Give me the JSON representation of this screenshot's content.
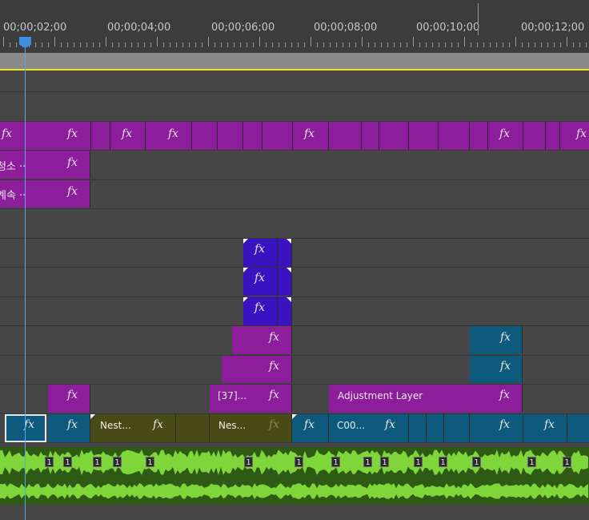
{
  "ruler": {
    "timecodes": [
      "00;00;02;00",
      "00;00;04;00",
      "00;00;06;00",
      "00;00;08;00",
      "00;00;10;00",
      "00;00;12;00"
    ]
  },
  "clips": {
    "fx_label": "fx",
    "v8_korean_1": "청소",
    "v8_korean_1_tail": "..",
    "v7_korean_2": "계속",
    "v7_korean_2_tail": "..",
    "v2_nest_37": "[37]...",
    "v2_adjustment": "Adjustment Layer",
    "v1_nest_a": "Nest...",
    "v1_nest_b": "Nes...",
    "v1_c00": "C00..."
  },
  "audio": {
    "clip_marker": "1"
  },
  "colors": {
    "purple": "#8c1e9c",
    "indigo": "#3a12c0",
    "teal": "#0e5a7c",
    "olive": "#4a4a16",
    "waveform": "#7ed63a",
    "playhead": "#5aa7e8",
    "work_area_line": "#f2e232"
  }
}
